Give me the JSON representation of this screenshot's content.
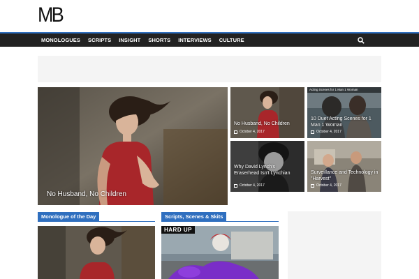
{
  "site": {
    "logo": "MB"
  },
  "nav": {
    "items": [
      "MONOLOGUES",
      "SCRIPTS",
      "INSIGHT",
      "SHORTS",
      "INTERVIEWS",
      "CULTURE"
    ],
    "search_icon": "search-icon"
  },
  "colors": {
    "accent": "#2f6fbf",
    "nav_bg": "#222222",
    "ad_bg": "#f4f4f4"
  },
  "featured": {
    "main": {
      "title": "No Husband, No Children"
    },
    "tiles": [
      {
        "title": "No Husband, No Children",
        "date": "October 4, 2017",
        "overlay": ""
      },
      {
        "title": "10 Duet Acting Scenes for 1 Man 1 Woman",
        "date": "October 4, 2017",
        "overlay": "Acting Scenes for 1 Man 1 Woman"
      },
      {
        "title": "Why David Lynch's Eraserhead Isn't Lynchian",
        "date": "October 4, 2017",
        "overlay": ""
      },
      {
        "title": "Surveillance and Technology in \"Harvest\"",
        "date": "October 4, 2017",
        "overlay": ""
      }
    ]
  },
  "sections": {
    "monologue": {
      "label": "Monologue of the Day"
    },
    "scripts": {
      "label": "Scripts, Scenes & Skits",
      "image_text": "HARD UP"
    }
  }
}
